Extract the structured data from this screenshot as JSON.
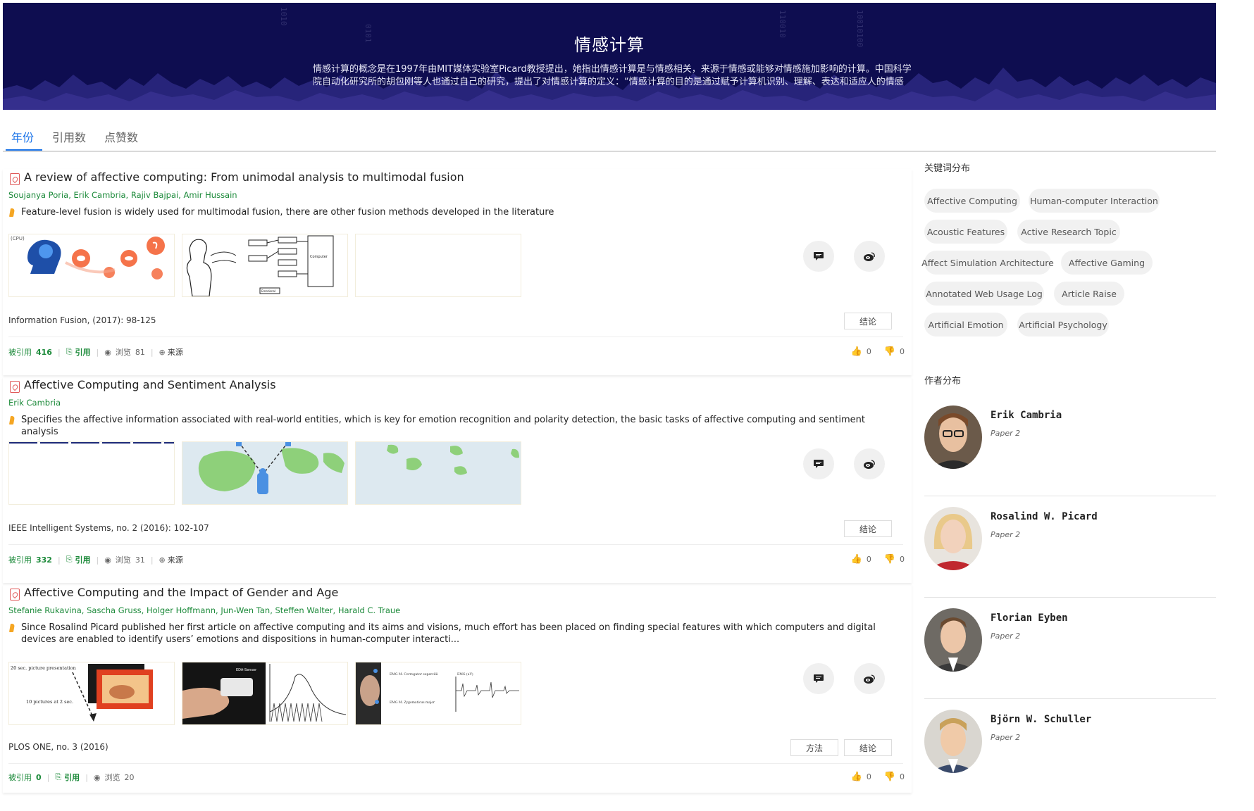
{
  "banner": {
    "title": "情感计算",
    "description": "情感计算的概念是在1997年由MIT媒体实验室Picard教授提出，她指出情感计算是与情感相关，来源于情感或能够对情感施加影响的计算。中国科学院自动化研究所的胡包刚等人也通过自己的研究，提出了对情感计算的定义：“情感计算的目的是通过赋予计算机识别、理解、表达和适应人的情感的能"
  },
  "tabs": [
    {
      "label": "年份"
    },
    {
      "label": "引用数"
    },
    {
      "label": "点赞数"
    }
  ],
  "papers": [
    {
      "title": "A review of affective computing: From unimodal analysis to multimodal fusion",
      "authors": "Soujanya Poria, Erik Cambria, Rajiv Bajpai, Amir Hussain",
      "summary": "Feature-level fusion is widely used for multimodal fusion, there are other fusion methods developed in the literature",
      "venue": "Information Fusion, (2017): 98-125",
      "tags": [
        "结论"
      ],
      "cited_label": "被引用",
      "cited_count": "416",
      "cite_label": "引用",
      "views_label": "浏览",
      "views_count": "81",
      "source_label": "来源",
      "likes": "0",
      "dislikes": "0"
    },
    {
      "title": "Affective Computing and Sentiment Analysis",
      "authors": "Erik Cambria",
      "summary": "Specifies the affective information associated with real-world entities, which is key for emotion recognition and polarity detection, the basic tasks of affective computing and sentiment analysis",
      "venue": "IEEE Intelligent Systems, no. 2 (2016): 102-107",
      "tags": [
        "结论"
      ],
      "cited_label": "被引用",
      "cited_count": "332",
      "cite_label": "引用",
      "views_label": "浏览",
      "views_count": "31",
      "source_label": "来源",
      "likes": "0",
      "dislikes": "0"
    },
    {
      "title": "Affective Computing and the Impact of Gender and Age",
      "authors": "Stefanie Rukavina, Sascha Gruss, Holger Hoffmann, Jun-Wen Tan, Steffen Walter, Harald C. Traue",
      "summary": "Since Rosalind Picard published her first article on affective computing and its aims and visions, much effort has been placed on finding special features with which computers and digital devices are enabled to identify users’ emotions and dispositions in human-computer interacti...",
      "venue": "PLOS ONE, no. 3 (2016)",
      "tags": [
        "方法",
        "结论"
      ],
      "cited_label": "被引用",
      "cited_count": "0",
      "cite_label": "引用",
      "views_label": "浏览",
      "views_count": "20",
      "likes": "0",
      "dislikes": "0"
    }
  ],
  "thumb_text": {
    "cpu": "(CPU)",
    "computer": "Computer",
    "emotional": "Emotional",
    "slide_title": "20 sec. picture presentation",
    "slide_sub": "10 pictures at 2 sec.",
    "eda_label": "EDA-Sensor",
    "emg1": "EMG M. Corrugator supercilii",
    "emg2": "EMG M. Zygomaticus major",
    "emg_unit": "EMG (uV)"
  },
  "sidebar": {
    "keywords_heading": "关键词分布",
    "keywords": [
      "Affective Computing",
      "Human-computer Interaction",
      "Acoustic Features",
      "Active Research Topic",
      "Affect Simulation Architecture",
      "Affective Gaming",
      "Annotated Web Usage Log",
      "Article Raise",
      "Artificial Emotion",
      "Artificial Psychology"
    ],
    "authors_heading": "作者分布",
    "authors": [
      {
        "name": "Erik Cambria",
        "papers": "Paper 2"
      },
      {
        "name": "Rosalind W. Picard",
        "papers": "Paper 2"
      },
      {
        "name": "Florian Eyben",
        "papers": "Paper 2"
      },
      {
        "name": "Björn W. Schuller",
        "papers": "Paper 2"
      }
    ]
  },
  "colors": {
    "banner_bg": "#0e0d50",
    "accent_blue": "#1a73e8",
    "author_green": "#1c8a3a",
    "highlight_orange": "#f5a623"
  }
}
